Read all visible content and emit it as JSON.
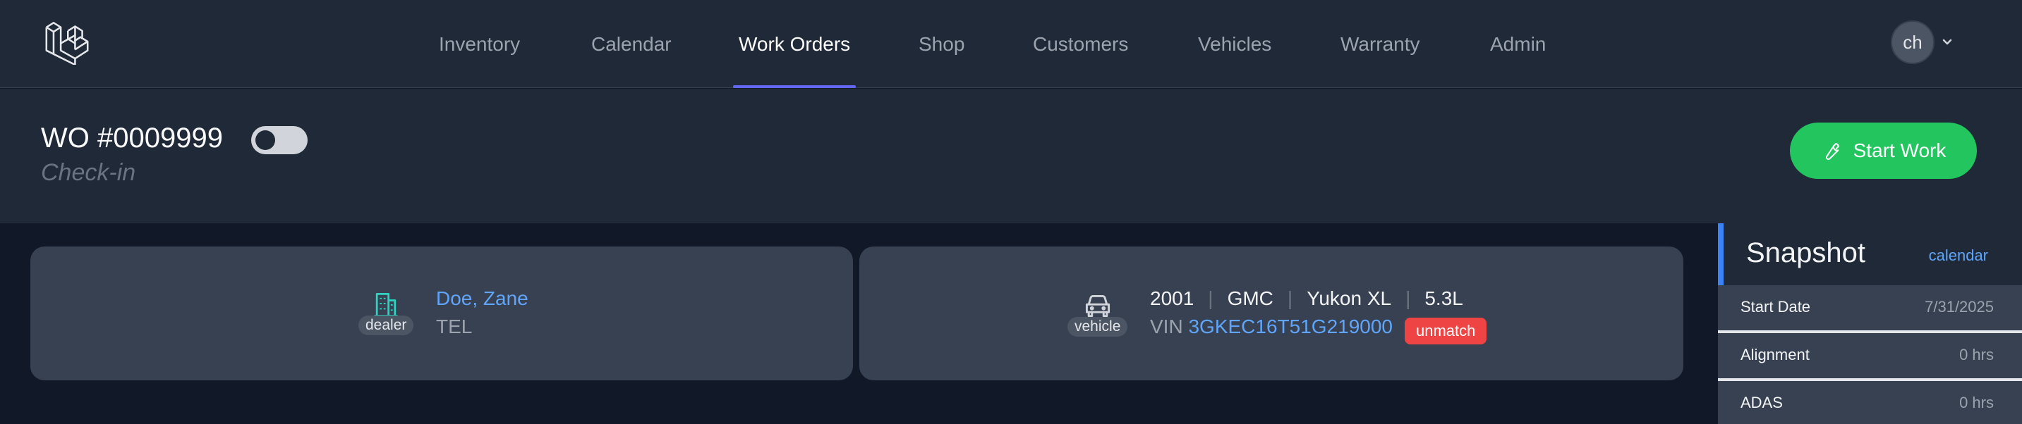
{
  "nav": {
    "items": [
      {
        "label": "Inventory"
      },
      {
        "label": "Calendar"
      },
      {
        "label": "Work Orders"
      },
      {
        "label": "Shop"
      },
      {
        "label": "Customers"
      },
      {
        "label": "Vehicles"
      },
      {
        "label": "Warranty"
      },
      {
        "label": "Admin"
      }
    ],
    "active": "Work Orders",
    "avatar_initials": "ch"
  },
  "header": {
    "title": "WO #0009999",
    "status": "Check-in",
    "start_button": "Start Work"
  },
  "customer_card": {
    "type_label": "dealer",
    "name": "Doe, Zane",
    "tel": "TEL"
  },
  "vehicle_card": {
    "type_label": "vehicle",
    "year": "2001",
    "make": "GMC",
    "model": "Yukon XL",
    "engine": "5.3L",
    "vin_label": "VIN",
    "vin": "3GKEC16T51G219000",
    "badge": "unmatch"
  },
  "snapshot": {
    "title": "Snapshot",
    "link": "calendar",
    "rows": [
      {
        "label": "Start Date",
        "value": "7/31/2025"
      },
      {
        "label": "Alignment",
        "value": "0 hrs"
      },
      {
        "label": "ADAS",
        "value": "0 hrs"
      }
    ]
  },
  "colors": {
    "accent": "#6366f1",
    "success": "#22c55e",
    "link": "#60a5fa",
    "danger": "#ef4444",
    "building_icon": "#2dd4bf"
  }
}
